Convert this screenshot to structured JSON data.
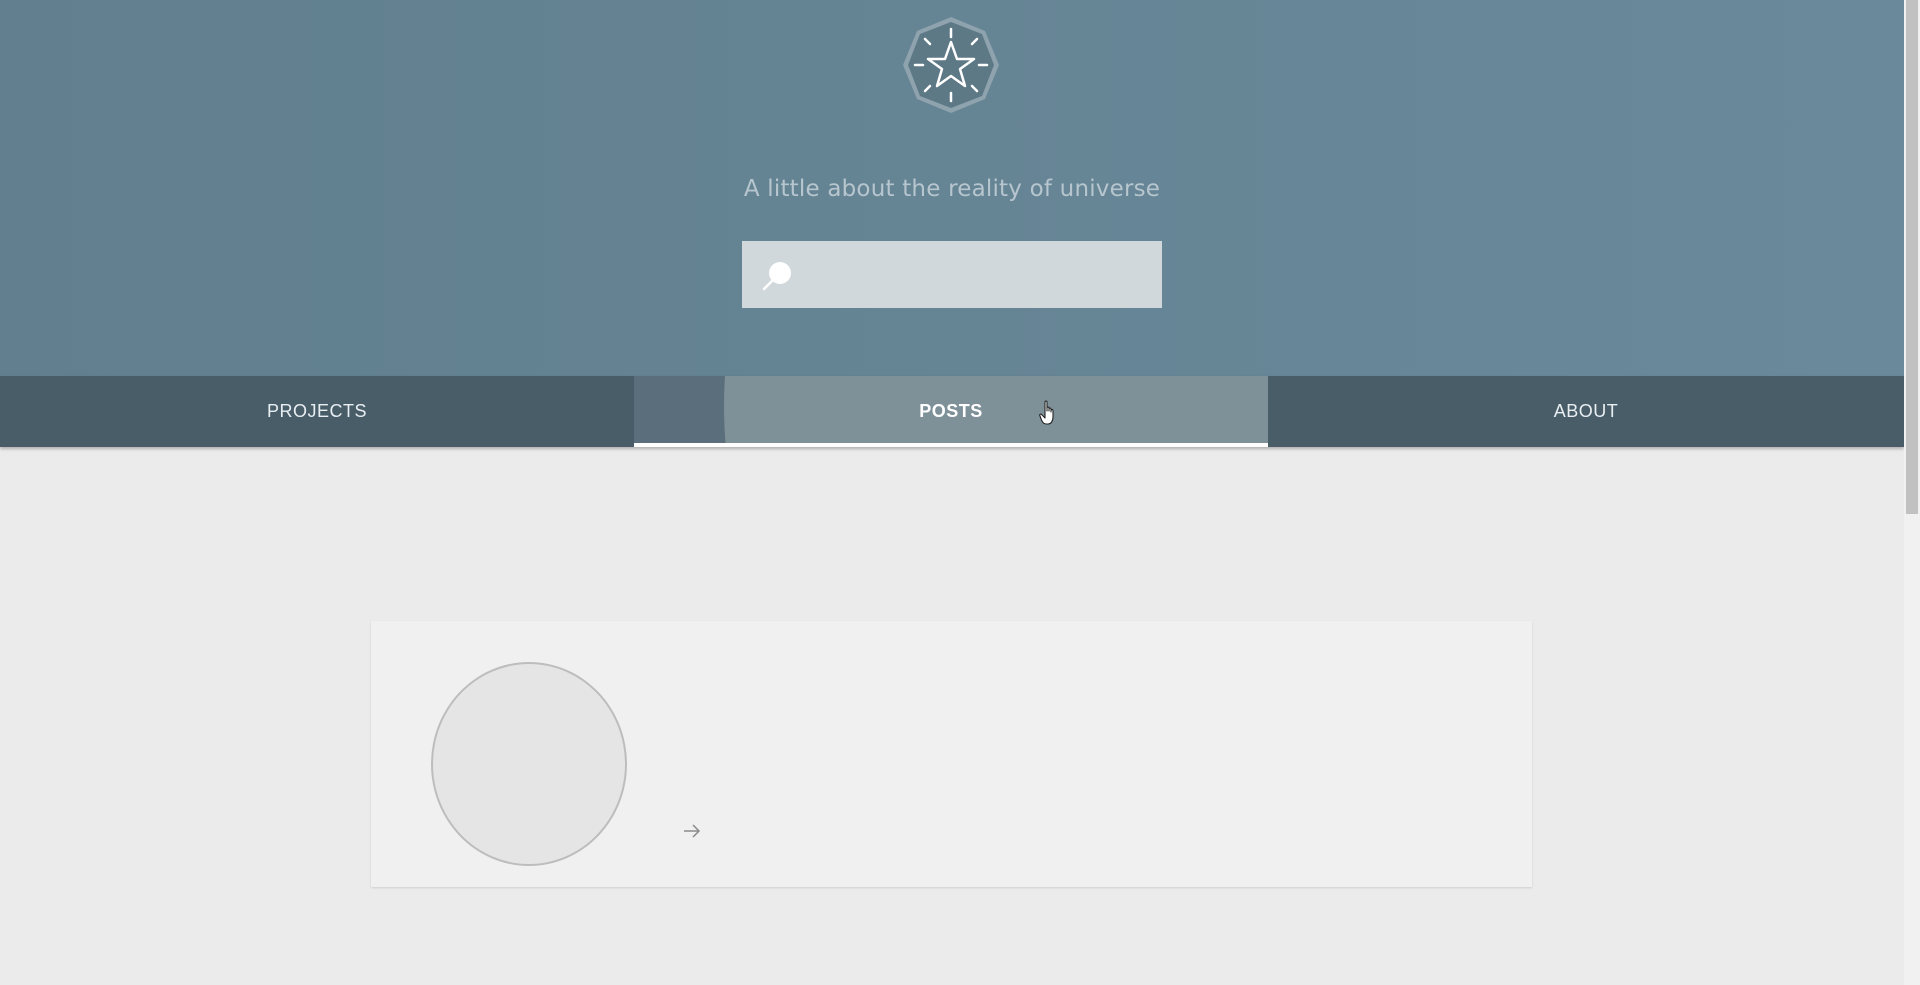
{
  "header": {
    "logo_icon": "star-octagon-logo-icon",
    "tagline": "A little about the reality of universe",
    "search": {
      "placeholder": "",
      "value": "",
      "icon": "search-icon"
    }
  },
  "nav": {
    "tabs": [
      {
        "label": "PROJECTS",
        "active": false
      },
      {
        "label": "POSTS",
        "active": true
      },
      {
        "label": "ABOUT",
        "active": false
      }
    ]
  },
  "main": {
    "card": {
      "avatar_icon": "avatar-placeholder",
      "arrow_icon": "arrow-right-icon"
    }
  },
  "colors": {
    "header_bg": "#658494",
    "nav_bg": "#495d69",
    "active_tab_bg": "#7e9199",
    "page_bg": "#ebebeb",
    "card_bg": "#f0f0f0"
  }
}
